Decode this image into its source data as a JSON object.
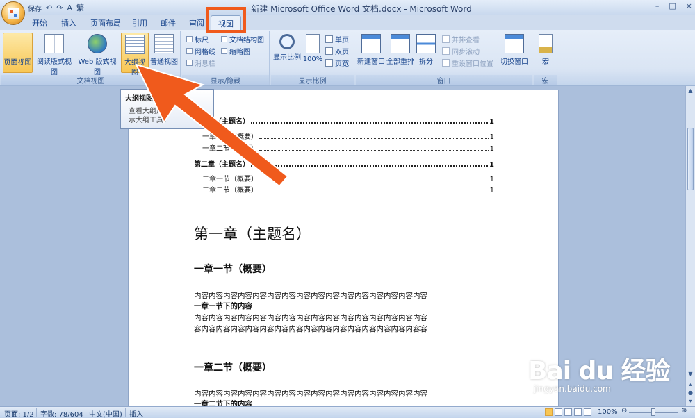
{
  "window": {
    "title": "新建 Microsoft Office Word 文档.docx - Microsoft Word",
    "controls": [
      "–",
      "□",
      "×"
    ]
  },
  "qat": {
    "items": [
      "保存",
      "↶",
      "↷",
      "A",
      "繁"
    ]
  },
  "tabs": [
    {
      "label": "开始"
    },
    {
      "label": "插入"
    },
    {
      "label": "页面布局"
    },
    {
      "label": "引用"
    },
    {
      "label": "邮件"
    },
    {
      "label": "审阅"
    },
    {
      "label": "视图",
      "active": true
    }
  ],
  "ribbon": {
    "doc_views": {
      "label": "文档视图",
      "buttons": [
        {
          "label": "页面视图",
          "icon": "page-layout-icon",
          "selected": true
        },
        {
          "label": "阅读版式视图",
          "icon": "reading-icon"
        },
        {
          "label": "Web 版式视图",
          "icon": "web-layout-icon"
        },
        {
          "label": "大纲视图",
          "icon": "outline-icon",
          "highlighted": true
        },
        {
          "label": "普通视图",
          "icon": "draft-icon"
        }
      ]
    },
    "show_hide": {
      "label": "显示/隐藏",
      "checks": [
        {
          "label": "标尺"
        },
        {
          "label": "网格线"
        },
        {
          "label": "消息栏",
          "disabled": true
        },
        {
          "label": "文档结构图"
        },
        {
          "label": "缩略图"
        }
      ]
    },
    "zoom": {
      "label": "显示比例",
      "buttons": [
        {
          "label": "显示比例"
        },
        {
          "label": "100%"
        }
      ],
      "small": [
        {
          "label": "单页"
        },
        {
          "label": "双页"
        },
        {
          "label": "页宽"
        }
      ]
    },
    "window": {
      "label": "窗口",
      "buttons": [
        {
          "label": "新建窗口"
        },
        {
          "label": "全部重排"
        },
        {
          "label": "拆分"
        },
        {
          "label": "切换窗口"
        }
      ],
      "small": [
        {
          "label": "并排查看"
        },
        {
          "label": "同步滚动"
        },
        {
          "label": "重设窗口位置"
        }
      ]
    },
    "macros": {
      "label": "宏",
      "button": "宏"
    }
  },
  "tooltip": {
    "title": "大纲视图",
    "line1": "查看大纲形式",
    "line2": "示大纲工具。"
  },
  "document": {
    "toc": [
      {
        "text": "第一章（主题名）",
        "page": "1",
        "level": 1
      },
      {
        "text": "一章一节（概要）",
        "page": "1",
        "level": 2
      },
      {
        "text": "一章二节（概要）",
        "page": "1",
        "level": 2
      },
      {
        "text": "第二章（主题名）",
        "page": "1",
        "level": 1
      },
      {
        "text": "二章一节（概要）",
        "page": "1",
        "level": 2
      },
      {
        "text": "二章二节（概要）",
        "page": "1",
        "level": 2
      }
    ],
    "heading1": "第一章（主题名）",
    "section1": {
      "heading": "一章一节（概要）",
      "line1": "内容内容内容内容内容内容内容内容内容内容内容内容内容内容内容内容",
      "bold": "一章一节下的内容",
      "line2": "内容内容内容内容内容内容内容内容内容内容内容内容内容内容内容内容",
      "line3": "容内容内容内容内容内容内容内容内容内容内容内容内容内容内容内容容"
    },
    "section2": {
      "heading": "一章二节（概要）",
      "line1": "内容内容内容内容内容内容内容内容内容内容内容内容内容内容内容内容",
      "bold": "一章二节下的内容"
    }
  },
  "status": {
    "page": "页面: 1/2",
    "words": "字数: 78/604",
    "lang": "中文(中国)",
    "mode": "插入",
    "zoom": "100%"
  },
  "watermark": {
    "text": "Bai du 经验",
    "url": "jingyan.baidu.com"
  },
  "colors": {
    "highlight": "#f05a1c",
    "ribbon_selected": "#f8c654"
  }
}
